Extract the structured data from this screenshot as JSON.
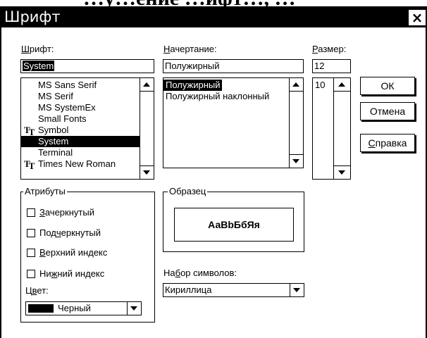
{
  "background_cut_text": "…у…ение …ифт…, …",
  "dialog": {
    "title": "Шрифт",
    "close_glyph": "×"
  },
  "font": {
    "label_underlined": "Ш",
    "label_rest": "рифт:",
    "value": "System",
    "items": [
      {
        "label": "MS Sans Serif",
        "truetype": false,
        "selected": false
      },
      {
        "label": "MS Serif",
        "truetype": false,
        "selected": false
      },
      {
        "label": "MS SystemEx",
        "truetype": false,
        "selected": false
      },
      {
        "label": "Small Fonts",
        "truetype": false,
        "selected": false
      },
      {
        "label": "Symbol",
        "truetype": true,
        "selected": false
      },
      {
        "label": "System",
        "truetype": false,
        "selected": true
      },
      {
        "label": "Terminal",
        "truetype": false,
        "selected": false
      },
      {
        "label": "Times New Roman",
        "truetype": true,
        "selected": false
      }
    ]
  },
  "style": {
    "label_underlined": "Н",
    "label_rest": "ачертание:",
    "value": "Полужирный",
    "items": [
      {
        "label": "Полужирный",
        "selected": true
      },
      {
        "label": "Полужирный наклонный",
        "selected": false
      }
    ]
  },
  "size": {
    "label_underlined": "Р",
    "label_rest": "азмер:",
    "value": "12",
    "items": [
      {
        "label": "10",
        "selected": false
      }
    ]
  },
  "buttons": {
    "ok": "ОК",
    "cancel": "Отмена",
    "help_underlined": "С",
    "help_rest": "правка"
  },
  "attributes": {
    "title": "Атрибуты",
    "strikeout": {
      "before": "",
      "underlined": "З",
      "after": "ачеркнутый",
      "checked": false
    },
    "underline": {
      "before": "Под",
      "underlined": "ч",
      "after": "еркнутый",
      "checked": false
    },
    "superscript": {
      "before": "",
      "underlined": "В",
      "after": "ерхний индекс",
      "checked": false
    },
    "subscript": {
      "before": "Ни",
      "underlined": "ж",
      "after": "ний индекс",
      "checked": false
    },
    "color_label_before": "Ц",
    "color_label_underlined": "в",
    "color_label_after": "ет:",
    "color_value": "Черный",
    "color_swatch": "#000000"
  },
  "sample": {
    "title": "Образец",
    "text": "АаВbБбЯя"
  },
  "charset": {
    "label_before": "На",
    "label_underlined": "б",
    "label_after": "ор символов:",
    "value": "Кириллица"
  }
}
